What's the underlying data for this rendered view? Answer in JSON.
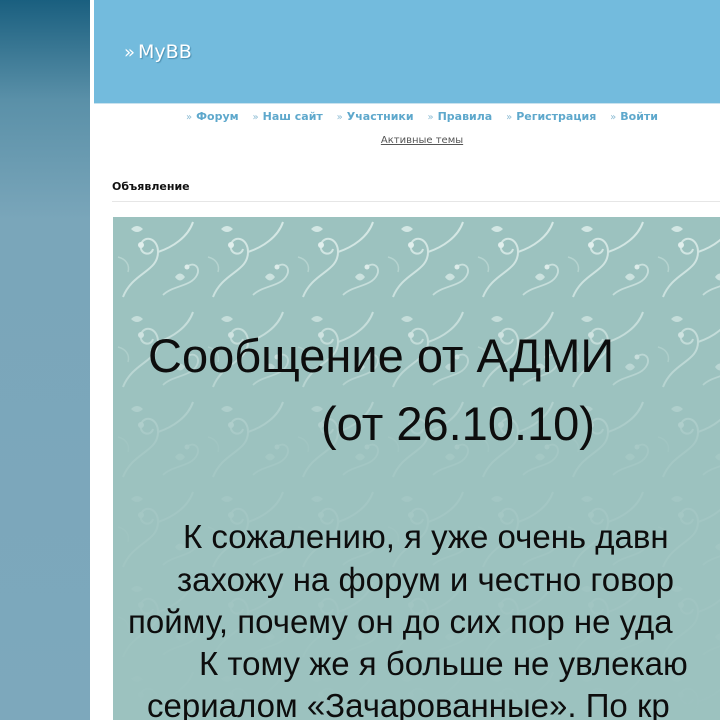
{
  "header": {
    "logo_mark": "»",
    "logo_text": "MyBB"
  },
  "nav": {
    "items": [
      {
        "label": "Форум"
      },
      {
        "label": "Наш сайт"
      },
      {
        "label": "Участники"
      },
      {
        "label": "Правила"
      },
      {
        "label": "Регистрация"
      },
      {
        "label": "Войти"
      }
    ],
    "arrow": "»",
    "active_topics": "Активные темы"
  },
  "announcement": {
    "title": "Объявление"
  },
  "banner": {
    "heading": "Сообщение от АДМИ",
    "date": "(от 26.10.10)",
    "lines": [
      "К сожалению, я уже очень давн",
      "захожу на форум и честно говор",
      "пойму, почему он до сих пор не уда",
      "К тому же я больше не увлекаю",
      "сериалом «Зачарованные». По кр"
    ]
  },
  "colors": {
    "header_bg": "#73bbdd",
    "nav_link": "#5ea8cc",
    "banner_bg": "#9cc2bf"
  }
}
